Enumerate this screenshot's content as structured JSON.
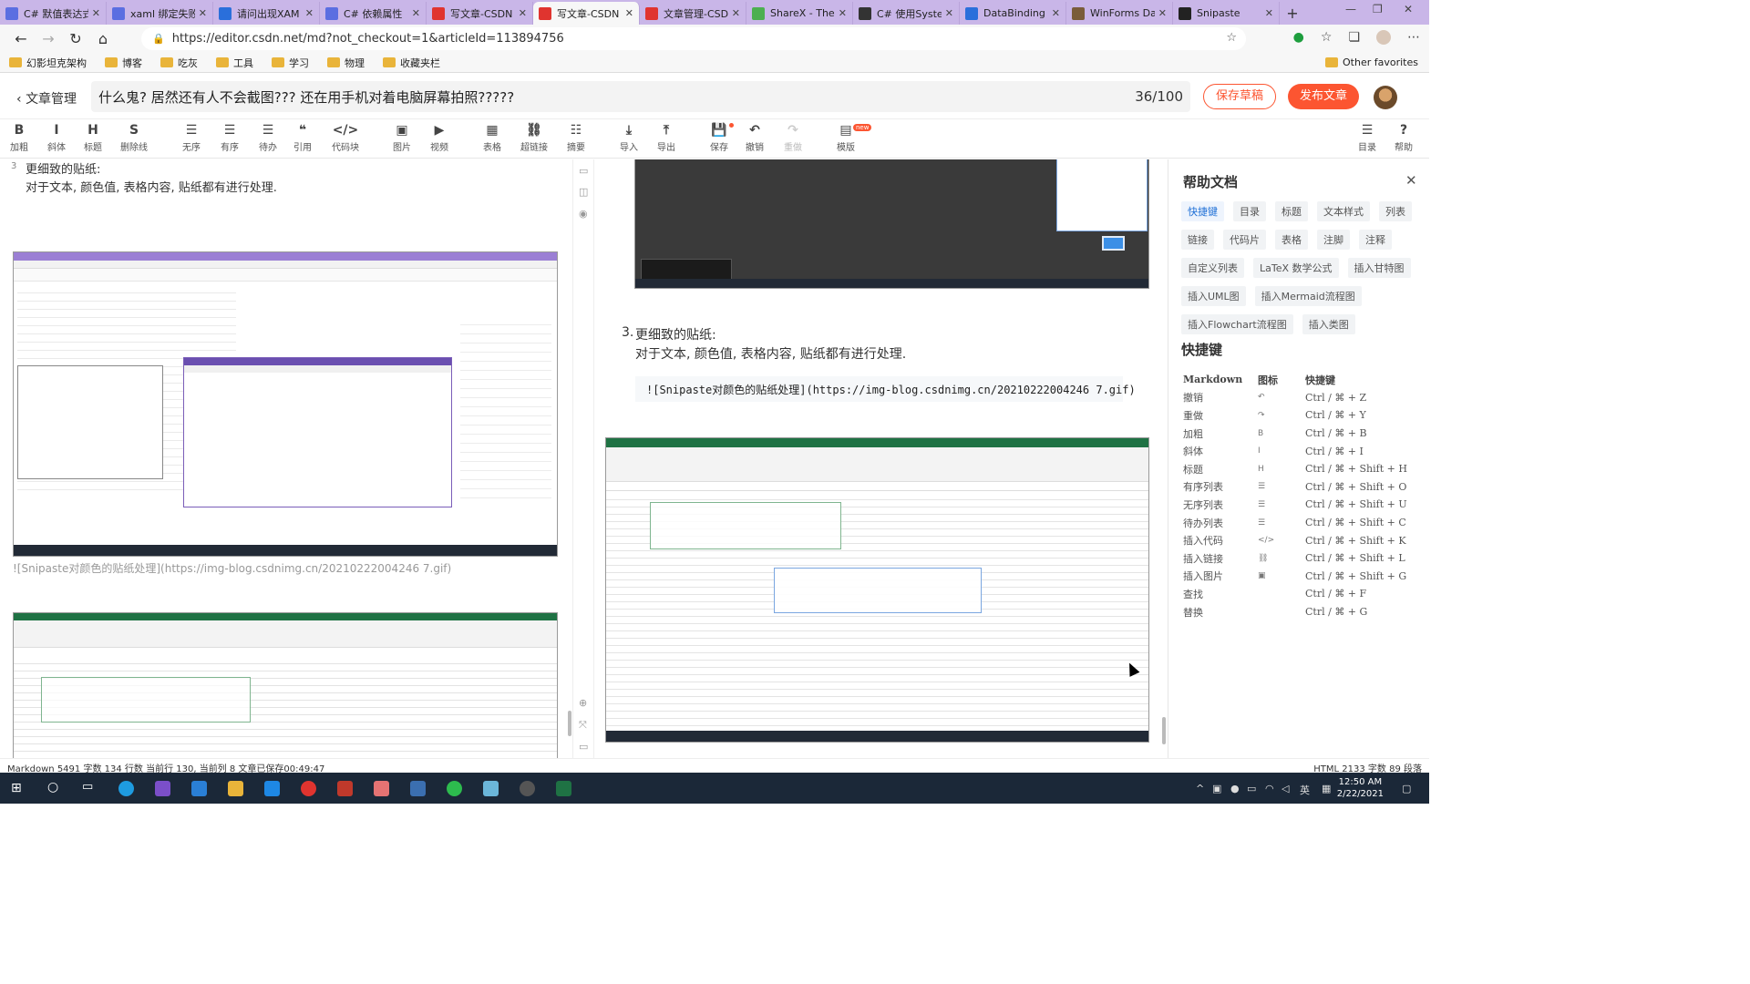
{
  "browser": {
    "tabs": [
      {
        "label": "C# 默值表达式",
        "color": "#5b6ee1"
      },
      {
        "label": "xaml 绑定失败",
        "color": "#5b6ee1"
      },
      {
        "label": "请问出现XAM",
        "color": "#2a6fdb"
      },
      {
        "label": "C# 依赖属性",
        "color": "#5b6ee1"
      },
      {
        "label": "写文章-CSDN",
        "color": "#e0342f"
      },
      {
        "label": "写文章-CSDN",
        "color": "#e0342f",
        "active": true
      },
      {
        "label": "文章管理-CSD",
        "color": "#e0342f"
      },
      {
        "label": "ShareX - The",
        "color": "#4caf50"
      },
      {
        "label": "C# 使用Syster",
        "color": "#333333"
      },
      {
        "label": "DataBinding",
        "color": "#2a6fdb"
      },
      {
        "label": "WinForms Da",
        "color": "#7a5c3a"
      },
      {
        "label": "Snipaste",
        "color": "#222222"
      }
    ],
    "url": "https://editor.csdn.net/md?not_checkout=1&articleId=113894756",
    "bookmarks": [
      "幻影坦克架构",
      "博客",
      "吃灰",
      "工具",
      "学习",
      "物理",
      "收藏夹栏"
    ],
    "other_favorites": "Other favorites"
  },
  "editor": {
    "back_label": "文章管理",
    "title": "什么鬼? 居然还有人不会截图??? 还在用手机对着电脑屏幕拍照?????",
    "title_count": "36/100",
    "save_draft": "保存草稿",
    "publish": "发布文章"
  },
  "toolbar": [
    {
      "icon": "B",
      "label": "加粗"
    },
    {
      "icon": "I",
      "label": "斜体"
    },
    {
      "icon": "H",
      "label": "标题"
    },
    {
      "icon": "S",
      "label": "删除线"
    },
    {
      "icon": "☰",
      "label": "无序"
    },
    {
      "icon": "☰",
      "label": "有序"
    },
    {
      "icon": "☰",
      "label": "待办"
    },
    {
      "icon": "❝",
      "label": "引用"
    },
    {
      "icon": "</>",
      "label": "代码块"
    },
    {
      "icon": "▣",
      "label": "图片"
    },
    {
      "icon": "▶",
      "label": "视频"
    },
    {
      "icon": "▦",
      "label": "表格"
    },
    {
      "icon": "⛓",
      "label": "超链接"
    },
    {
      "icon": "☷",
      "label": "摘要"
    },
    {
      "icon": "⤓",
      "label": "导入"
    },
    {
      "icon": "⤒",
      "label": "导出"
    },
    {
      "icon": "💾",
      "label": "保存"
    },
    {
      "icon": "↶",
      "label": "撤销"
    },
    {
      "icon": "↷",
      "label": "重做"
    },
    {
      "icon": "▤",
      "label": "模版"
    },
    {
      "icon": "☰",
      "label": "目录"
    },
    {
      "icon": "?",
      "label": "帮助"
    }
  ],
  "new_badge": "new",
  "left_pane": {
    "line_num": "3",
    "line1": "更细致的贴纸:",
    "line2": "对于文本, 颜色值, 表格内容, 贴纸都有进行处理.",
    "img_link": "![Snipaste对颜色的贴纸处理](https://img-blog.csdnimg.cn/20210222004246 7.gif)"
  },
  "preview": {
    "item_num": "3.",
    "item_title": "更细致的贴纸:",
    "item_text": "对于文本, 颜色值, 表格内容, 贴纸都有进行处理.",
    "code": "![Snipaste对颜色的贴纸处理](https://img-blog.csdnimg.cn/20210222004246 7.gif)"
  },
  "help": {
    "title": "帮助文档",
    "tags": [
      "快捷键",
      "目录",
      "标题",
      "文本样式",
      "列表",
      "链接",
      "代码片",
      "表格",
      "注脚",
      "注释",
      "自定义列表",
      "LaTeX 数学公式",
      "插入甘特图",
      "插入UML图",
      "插入Mermaid流程图",
      "插入Flowchart流程图",
      "插入类图"
    ],
    "shortcut_heading": "快捷键",
    "cols": [
      "Markdown",
      "图标",
      "快捷键"
    ],
    "rows": [
      {
        "md": "撤销",
        "icon": "↶",
        "key": "Ctrl / ⌘ + Z"
      },
      {
        "md": "重做",
        "icon": "↷",
        "key": "Ctrl / ⌘ + Y"
      },
      {
        "md": "加粗",
        "icon": "B",
        "key": "Ctrl / ⌘ + B"
      },
      {
        "md": "斜体",
        "icon": "I",
        "key": "Ctrl / ⌘ + I"
      },
      {
        "md": "标题",
        "icon": "H",
        "key": "Ctrl / ⌘ + Shift + H"
      },
      {
        "md": "有序列表",
        "icon": "☰",
        "key": "Ctrl / ⌘ + Shift + O"
      },
      {
        "md": "无序列表",
        "icon": "☰",
        "key": "Ctrl / ⌘ + Shift + U"
      },
      {
        "md": "待办列表",
        "icon": "☰",
        "key": "Ctrl / ⌘ + Shift + C"
      },
      {
        "md": "插入代码",
        "icon": "</>",
        "key": "Ctrl / ⌘ + Shift + K"
      },
      {
        "md": "插入链接",
        "icon": "⛓",
        "key": "Ctrl / ⌘ + Shift + L"
      },
      {
        "md": "插入图片",
        "icon": "▣",
        "key": "Ctrl / ⌘ + Shift + G"
      },
      {
        "md": "查找",
        "icon": "",
        "key": "Ctrl / ⌘ + F"
      },
      {
        "md": "替换",
        "icon": "",
        "key": "Ctrl / ⌘ + G"
      }
    ]
  },
  "status": {
    "left": "Markdown  5491 字数  134 行数  当前行 130, 当前列 8  文章已保存00:49:47",
    "right": "HTML  2133 字数  89 段落"
  },
  "taskbar": {
    "time": "12:50 AM",
    "date": "2/22/2021",
    "ime": "英"
  }
}
